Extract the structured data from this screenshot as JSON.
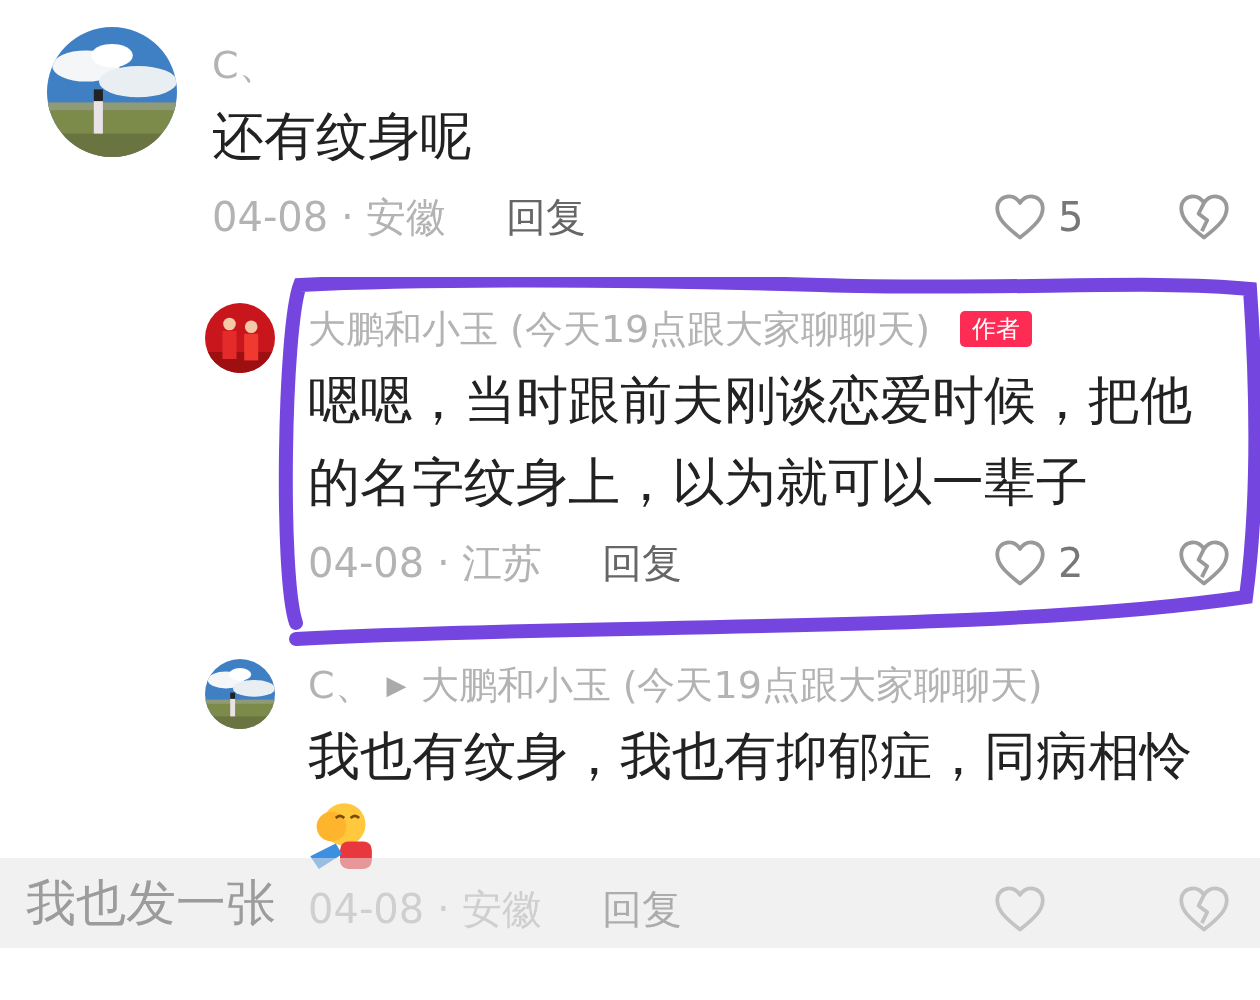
{
  "comments": [
    {
      "author": "C、",
      "text": "还有纹身呢",
      "date": "04-08 · 安徽",
      "reply": "回复",
      "likes": "5",
      "is_reply": false
    },
    {
      "author": "大鹏和小玉 (今天19点跟大家聊聊天)",
      "badge": "作者",
      "text": "嗯嗯，当时跟前夫刚谈恋爱时候，把他的名字纹身上，以为就可以一辈子",
      "date": "04-08 · 江苏",
      "reply": "回复",
      "likes": "2",
      "is_reply": true,
      "circled": true
    },
    {
      "author": "C、",
      "reply_arrow": "▶",
      "reply_to": "大鹏和小玉 (今天19点跟大家聊聊天)",
      "text": "我也有纹身，我也有抑郁症，同病相怜",
      "emoji": true,
      "date": "04-08 · 安徽",
      "reply": "回复",
      "is_reply": true
    }
  ],
  "input": {
    "placeholder": "我也发一张"
  }
}
